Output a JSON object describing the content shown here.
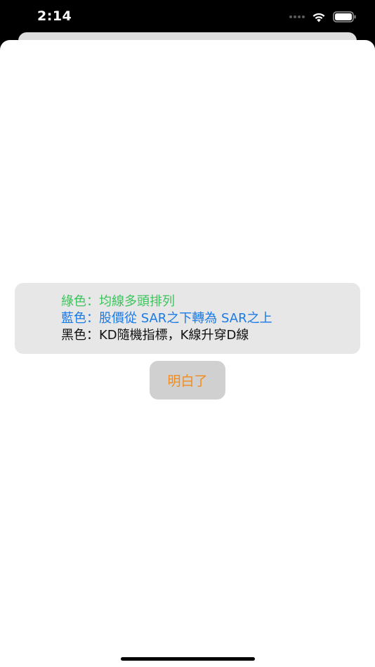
{
  "status_bar": {
    "time": "2:14"
  },
  "legend": {
    "green_line": "綠色：均線多頭排列",
    "blue_line": "藍色：股價從 SAR之下轉為 SAR之上",
    "black_line": "黑色：KD隨機指標，K線升穿D線"
  },
  "dialog": {
    "confirm_label": "明白了"
  },
  "colors": {
    "green": "#3cc35b",
    "blue": "#1a7ae6",
    "black": "#111111",
    "button_text": "#f28b1c",
    "button_bg": "#d0d0d0",
    "box_bg": "#e7e7e7"
  },
  "icons": [
    "wifi-icon",
    "battery-icon",
    "cellular-signal-icon"
  ]
}
